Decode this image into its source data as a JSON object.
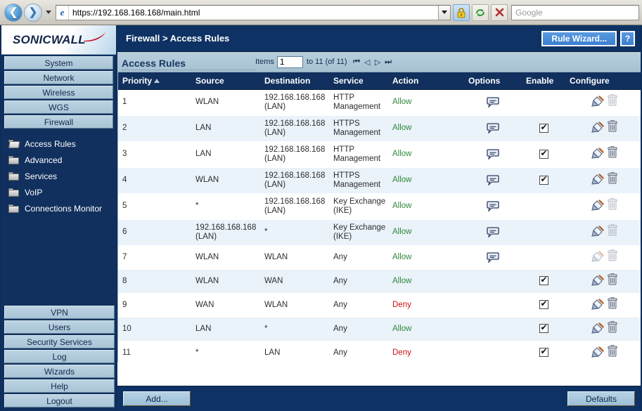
{
  "browser": {
    "url": "https://192.168.168.168/main.html",
    "search_placeholder": "Google",
    "back_icon": "back-arrow-icon",
    "forward_icon": "forward-arrow-icon",
    "favicon": "e",
    "lock_icon": "padlock-icon",
    "refresh_icon": "refresh-icon",
    "stop_icon": "stop-icon"
  },
  "sidebar": {
    "logo": "SONICWALL",
    "top_nav": [
      {
        "label": "System"
      },
      {
        "label": "Network"
      },
      {
        "label": "Wireless"
      },
      {
        "label": "WGS"
      },
      {
        "label": "Firewall"
      }
    ],
    "tree": [
      {
        "label": "Access Rules",
        "icon": "open-folder-icon",
        "selected": true
      },
      {
        "label": "Advanced",
        "icon": "folder-icon",
        "selected": false
      },
      {
        "label": "Services",
        "icon": "folder-icon",
        "selected": false
      },
      {
        "label": "VoIP",
        "icon": "folder-icon",
        "selected": false
      },
      {
        "label": "Connections Monitor",
        "icon": "folder-icon",
        "selected": false
      }
    ],
    "bottom_nav": [
      {
        "label": "VPN"
      },
      {
        "label": "Users"
      },
      {
        "label": "Security Services"
      },
      {
        "label": "Log"
      },
      {
        "label": "Wizards"
      },
      {
        "label": "Help"
      },
      {
        "label": "Logout"
      }
    ]
  },
  "header": {
    "breadcrumb": "Firewall > Access Rules",
    "rule_wizard_label": "Rule Wizard...",
    "help_label": "?"
  },
  "subheader": {
    "section_title": "Access Rules",
    "items_label": "Items",
    "items_value": "1",
    "range_label": "to 11 (of 11)",
    "pager": {
      "first": "⏮",
      "prev": "◁",
      "next": "▷",
      "last": "⏭"
    }
  },
  "table": {
    "columns": [
      "Priority",
      "Source",
      "Destination",
      "Service",
      "Action",
      "Options",
      "Enable",
      "Configure"
    ],
    "sort_column": "Priority",
    "sort_direction": "asc",
    "rows": [
      {
        "priority": "1",
        "source": "WLAN",
        "destination": "192.168.168.168 (LAN)",
        "service": "HTTP Management",
        "action": "Allow",
        "action_type": "allow",
        "options": true,
        "enable": false,
        "edit": true,
        "delete": false
      },
      {
        "priority": "2",
        "source": "LAN",
        "destination": "192.168.168.168 (LAN)",
        "service": "HTTPS Management",
        "action": "Allow",
        "action_type": "allow",
        "options": true,
        "enable": true,
        "edit": true,
        "delete": true
      },
      {
        "priority": "3",
        "source": "LAN",
        "destination": "192.168.168.168 (LAN)",
        "service": "HTTP Management",
        "action": "Allow",
        "action_type": "allow",
        "options": true,
        "enable": true,
        "edit": true,
        "delete": true
      },
      {
        "priority": "4",
        "source": "WLAN",
        "destination": "192.168.168.168 (LAN)",
        "service": "HTTPS Management",
        "action": "Allow",
        "action_type": "allow",
        "options": true,
        "enable": true,
        "edit": true,
        "delete": true
      },
      {
        "priority": "5",
        "source": "*",
        "destination": "192.168.168.168 (LAN)",
        "service": "Key Exchange (IKE)",
        "action": "Allow",
        "action_type": "allow",
        "options": true,
        "enable": false,
        "edit": true,
        "delete": false
      },
      {
        "priority": "6",
        "source": "192.168.168.168 (LAN)",
        "destination": "*",
        "service": "Key Exchange (IKE)",
        "action": "Allow",
        "action_type": "allow",
        "options": true,
        "enable": false,
        "edit": true,
        "delete": false
      },
      {
        "priority": "7",
        "source": "WLAN",
        "destination": "WLAN",
        "service": "Any",
        "action": "Allow",
        "action_type": "allow",
        "options": true,
        "enable": false,
        "edit": false,
        "delete": false
      },
      {
        "priority": "8",
        "source": "WLAN",
        "destination": "WAN",
        "service": "Any",
        "action": "Allow",
        "action_type": "allow",
        "options": false,
        "enable": true,
        "edit": true,
        "delete": true
      },
      {
        "priority": "9",
        "source": "WAN",
        "destination": "WLAN",
        "service": "Any",
        "action": "Deny",
        "action_type": "deny",
        "options": false,
        "enable": true,
        "edit": true,
        "delete": true
      },
      {
        "priority": "10",
        "source": "LAN",
        "destination": "*",
        "service": "Any",
        "action": "Allow",
        "action_type": "allow",
        "options": false,
        "enable": true,
        "edit": true,
        "delete": true
      },
      {
        "priority": "11",
        "source": "*",
        "destination": "LAN",
        "service": "Any",
        "action": "Deny",
        "action_type": "deny",
        "options": false,
        "enable": true,
        "edit": true,
        "delete": true
      }
    ]
  },
  "footer": {
    "add_label": "Add...",
    "defaults_label": "Defaults"
  },
  "colors": {
    "navy": "#11305e",
    "title_navy": "#0e3263",
    "panel_blue": "#a6c1d2",
    "allow_green": "#2f8a3c",
    "deny_red": "#cc1111",
    "row_alt": "#eaf2fa",
    "accent_button": "#3a7fd0"
  }
}
